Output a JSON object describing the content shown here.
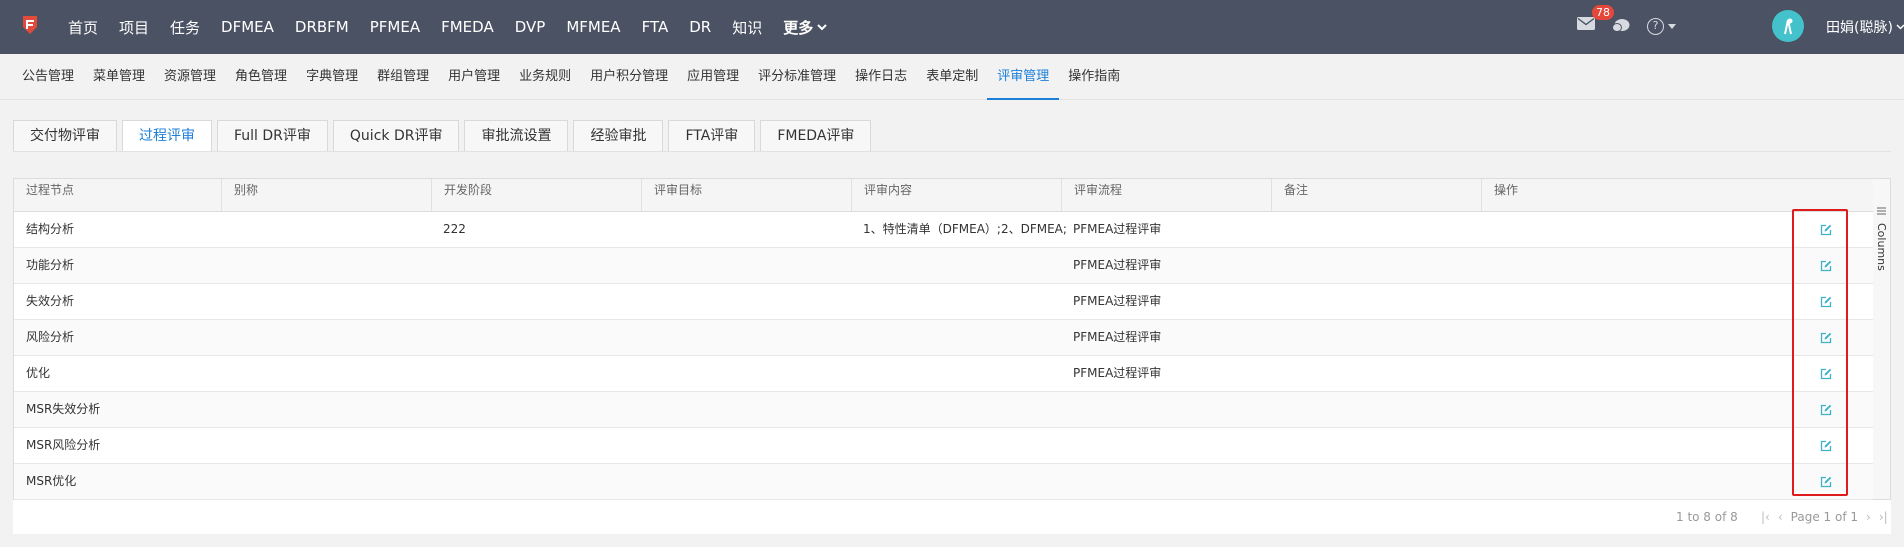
{
  "topbar": {
    "nav": [
      "首页",
      "项目",
      "任务",
      "DFMEA",
      "DRBFM",
      "PFMEA",
      "FMEDA",
      "DVP",
      "MFMEA",
      "FTA",
      "DR",
      "知识"
    ],
    "more_label": "更多",
    "mail_badge": "78",
    "help_icon_text": "?",
    "username": "田娟(聪脉)",
    "bg_color": "#4a5263"
  },
  "subnav": {
    "items": [
      "公告管理",
      "菜单管理",
      "资源管理",
      "角色管理",
      "字典管理",
      "群组管理",
      "用户管理",
      "业务规则",
      "用户积分管理",
      "应用管理",
      "评分标准管理",
      "操作日志",
      "表单定制",
      "评审管理",
      "操作指南"
    ],
    "active": "评审管理"
  },
  "tabs": {
    "items": [
      "交付物评审",
      "过程评审",
      "Full DR评审",
      "Quick DR评审",
      "审批流设置",
      "经验审批",
      "FTA评审",
      "FMEDA评审"
    ],
    "active": "过程评审"
  },
  "grid": {
    "columns": [
      "过程节点",
      "别称",
      "开发阶段",
      "评审目标",
      "评审内容",
      "评审流程",
      "备注",
      "操作"
    ],
    "rows": [
      {
        "node": "结构分析",
        "alias": "",
        "stage": "222",
        "goal": "",
        "content": "1、特性清单（DFMEA）;2、DFMEA;",
        "flow": "PFMEA过程评审",
        "remark": ""
      },
      {
        "node": "功能分析",
        "alias": "",
        "stage": "",
        "goal": "",
        "content": "",
        "flow": "PFMEA过程评审",
        "remark": ""
      },
      {
        "node": "失效分析",
        "alias": "",
        "stage": "",
        "goal": "",
        "content": "",
        "flow": "PFMEA过程评审",
        "remark": ""
      },
      {
        "node": "风险分析",
        "alias": "",
        "stage": "",
        "goal": "",
        "content": "",
        "flow": "PFMEA过程评审",
        "remark": ""
      },
      {
        "node": "优化",
        "alias": "",
        "stage": "",
        "goal": "",
        "content": "",
        "flow": "PFMEA过程评审",
        "remark": ""
      },
      {
        "node": "MSR失效分析",
        "alias": "",
        "stage": "",
        "goal": "",
        "content": "",
        "flow": "",
        "remark": ""
      },
      {
        "node": "MSR风险分析",
        "alias": "",
        "stage": "",
        "goal": "",
        "content": "",
        "flow": "",
        "remark": ""
      },
      {
        "node": "MSR优化",
        "alias": "",
        "stage": "",
        "goal": "",
        "content": "",
        "flow": "",
        "remark": ""
      }
    ],
    "side_panel_label": "Columns",
    "edit_icon": "edit-icon",
    "highlight_color": "#e01b1b"
  },
  "pagination": {
    "summary": "1 to 8 of 8",
    "page_text": "Page 1 of 1"
  },
  "colors": {
    "accent": "#1c7fd8",
    "edit_icon": "#3fb1c9",
    "badge": "#e5483b",
    "avatar": "#44c2cb"
  }
}
